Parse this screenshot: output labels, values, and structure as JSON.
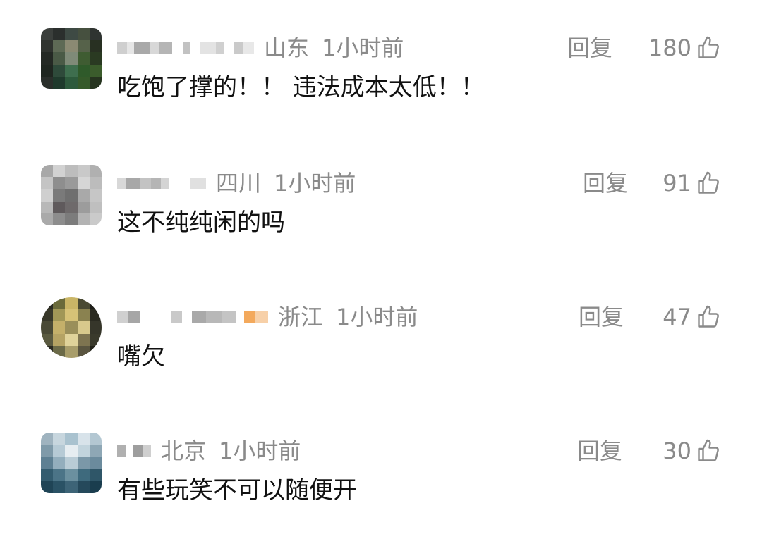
{
  "comments": [
    {
      "region": "山东",
      "time": "1小时前",
      "reply_label": "回复",
      "likes": "180",
      "text": "吃饱了撑的！！ 违法成本太低！！",
      "like_icon": "thumbs-up-icon"
    },
    {
      "region": "四川",
      "time": "1小时前",
      "reply_label": "回复",
      "likes": "91",
      "text": "这不纯纯闲的吗",
      "like_icon": "thumbs-up-icon"
    },
    {
      "region": "浙江",
      "time": "1小时前",
      "reply_label": "回复",
      "likes": "47",
      "text": "嘴欠",
      "like_icon": "thumbs-up-icon"
    },
    {
      "region": "北京",
      "time": "1小时前",
      "reply_label": "回复",
      "likes": "30",
      "text": "有些玩笑不可以随便开",
      "like_icon": "thumbs-up-icon"
    }
  ],
  "colors": {
    "meta_gray": "#8a8a8a",
    "text": "#111111",
    "background": "#ffffff"
  }
}
